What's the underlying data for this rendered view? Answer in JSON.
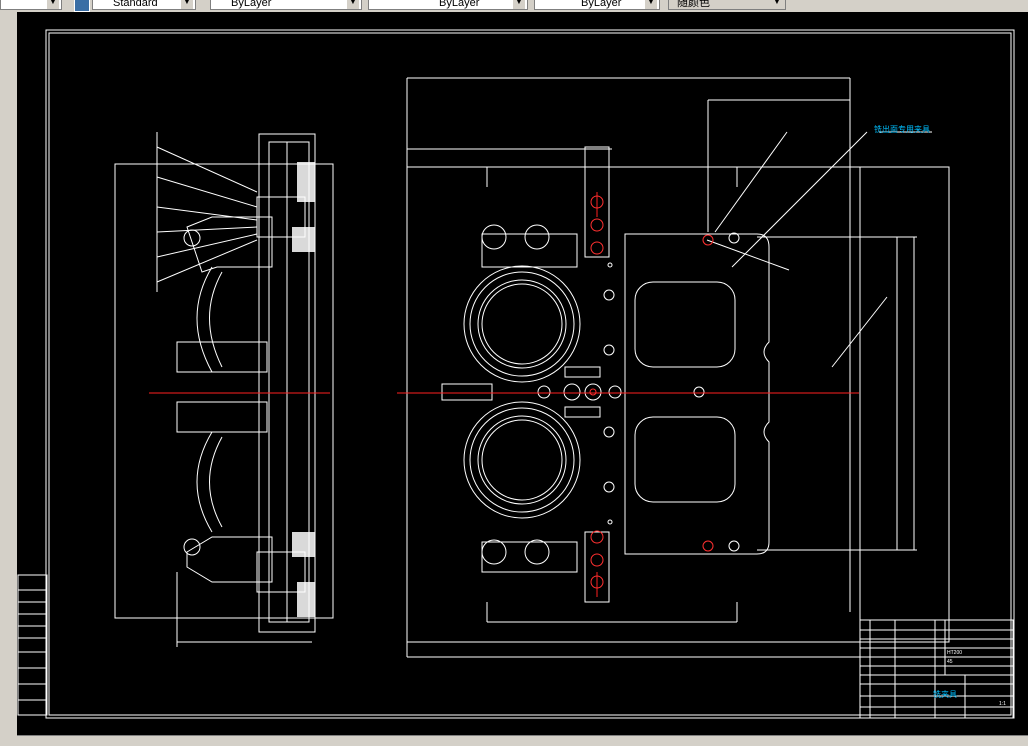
{
  "toolbar": {
    "text_style": "Standard",
    "layer": "ByLayer",
    "linetype": "ByLayer",
    "lineweight": "ByLayer",
    "color": "随颜色"
  },
  "drawing": {
    "title_label": "铣出面专用夹具",
    "block_title": "铣夹具",
    "material_1": "45",
    "material_2": "HT200",
    "scale": "1:1",
    "frame_color": "#ffffff",
    "center_line_color": "#ff2020",
    "hole_color": "#ff3030",
    "leader_color": "#00bfff"
  }
}
